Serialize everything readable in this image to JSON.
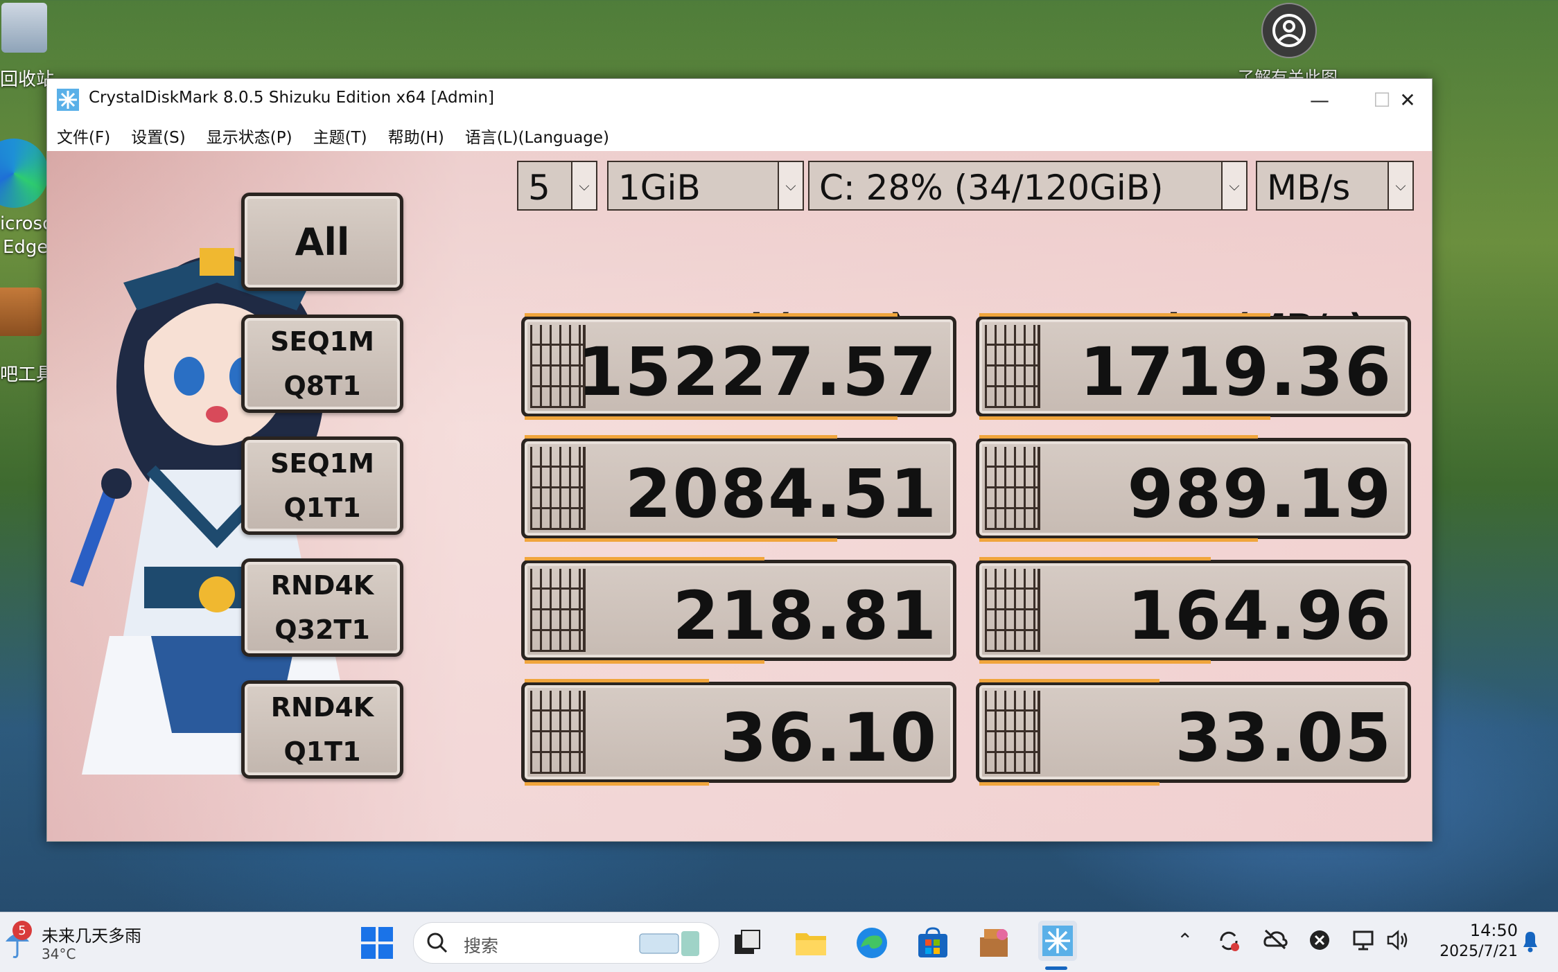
{
  "desktop": {
    "recycle_bin_label": "回收站",
    "edge_label_1": "icroso",
    "edge_label_2": "Edge",
    "tools_label": "吧工具",
    "spotlight_label": "了解有关此图"
  },
  "window": {
    "title": "CrystalDiskMark 8.0.5 Shizuku Edition x64 [Admin]",
    "minimize": "—",
    "maximize": "☐",
    "close": "✕"
  },
  "menu": [
    "文件(F)",
    "设置(S)",
    "显示状态(P)",
    "主题(T)",
    "帮助(H)",
    "语言(L)(Language)"
  ],
  "controls": {
    "all_label": "All",
    "count": "5",
    "size": "1GiB",
    "drive": "C: 28% (34/120GiB)",
    "unit": "MB/s"
  },
  "headers": {
    "read": "Read (MB/s)",
    "write": "Write (MB/s)"
  },
  "tests": [
    {
      "line1": "SEQ1M",
      "line2": "Q8T1",
      "read": "15227.57",
      "write": "1719.36",
      "read_level": 0.87,
      "write_level": 0.68
    },
    {
      "line1": "SEQ1M",
      "line2": "Q1T1",
      "read": "2084.51",
      "write": "989.19",
      "read_level": 0.73,
      "write_level": 0.65
    },
    {
      "line1": "RND4K",
      "line2": "Q32T1",
      "read": "218.81",
      "write": "164.96",
      "read_level": 0.56,
      "write_level": 0.54
    },
    {
      "line1": "RND4K",
      "line2": "Q1T1",
      "read": "36.10",
      "write": "33.05",
      "read_level": 0.43,
      "write_level": 0.42
    }
  ],
  "taskbar": {
    "weather_badge": "5",
    "weather_text": "未来几天多雨",
    "weather_temp": "34°C",
    "search_placeholder": "搜索",
    "time": "14:50",
    "date": "2025/7/21"
  },
  "colors": {
    "accent_bar": "#f0a53c",
    "frame": "#2a2420",
    "taskbar_active": "#1565c0"
  }
}
